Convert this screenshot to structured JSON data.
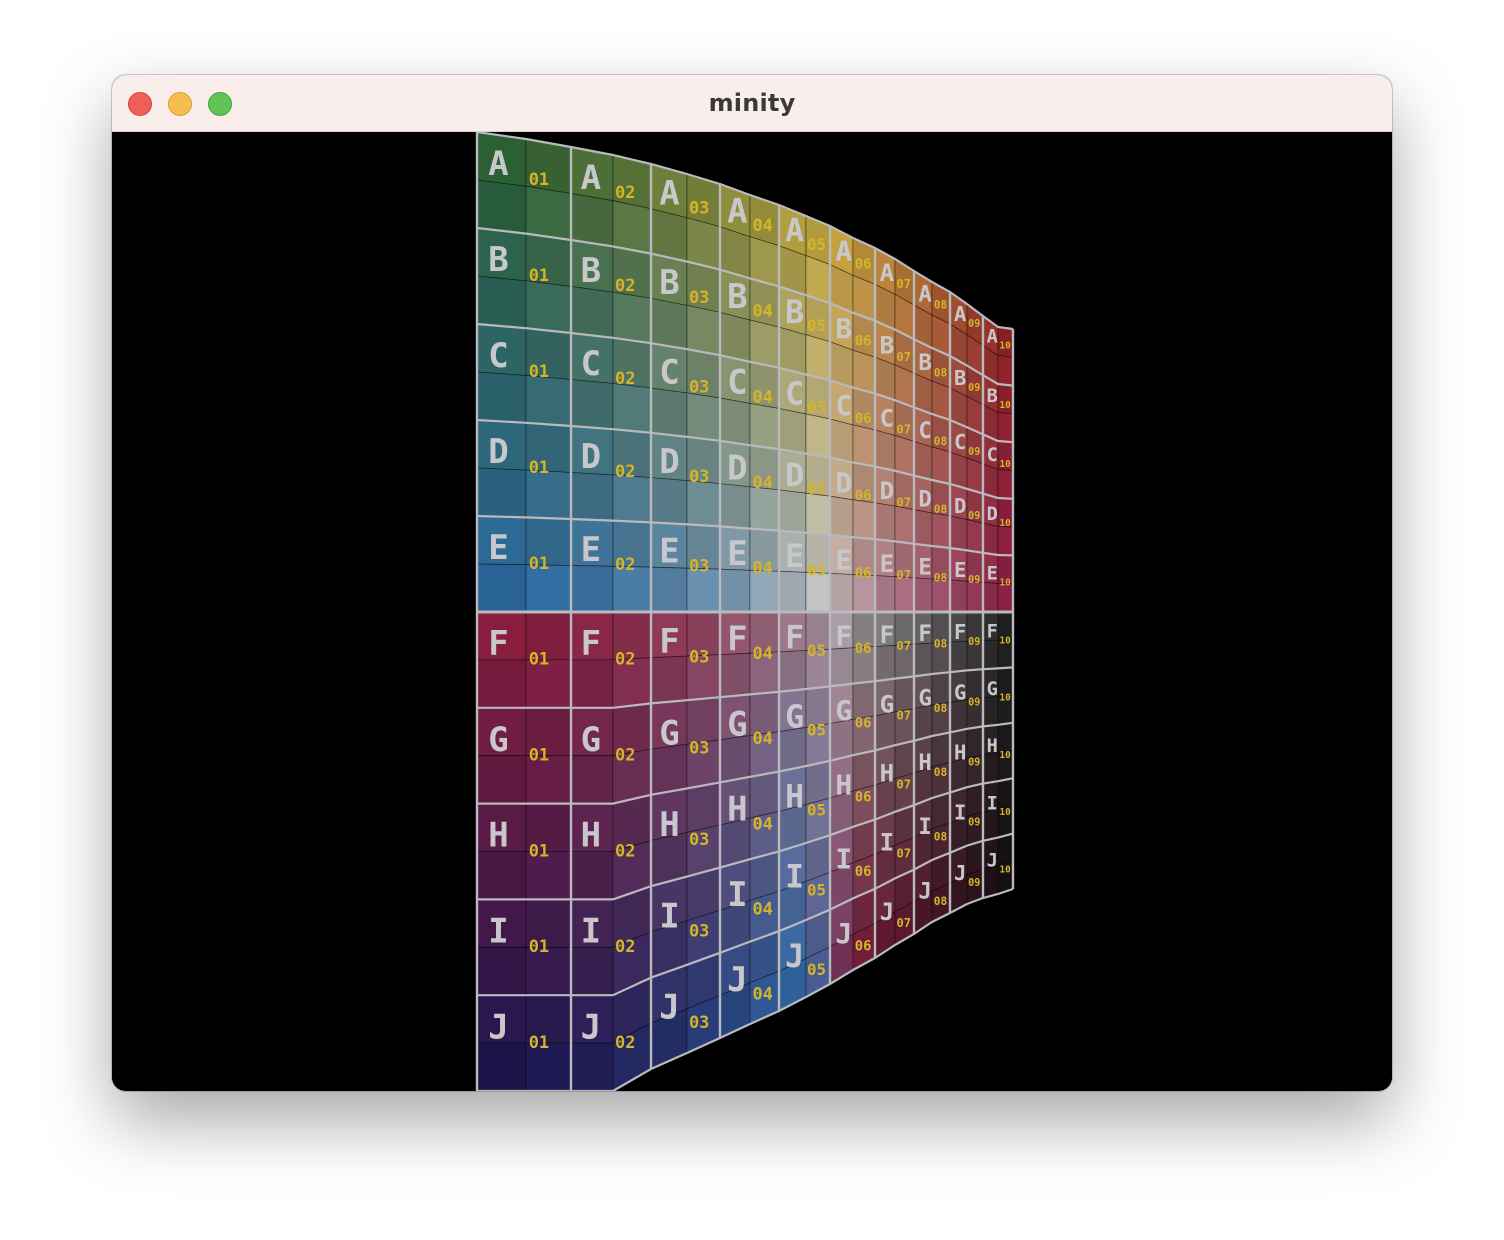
{
  "window": {
    "title": "minity",
    "buttons": {
      "close": "close",
      "minimize": "minimize",
      "zoom": "zoom"
    }
  },
  "scene": {
    "description_free": true,
    "columns": 10,
    "rows": 10,
    "row_letters": [
      "A",
      "B",
      "C",
      "D",
      "E",
      "F",
      "G",
      "H",
      "I",
      "J"
    ],
    "column_numbers": [
      "01",
      "02",
      "03",
      "04",
      "05",
      "06",
      "07",
      "08",
      "09",
      "10"
    ],
    "colors": {
      "top_left": "#235c2e",
      "top_center": "#c9a83a",
      "top_right": "#8e1c24",
      "mid_left": "#2b6aa6",
      "mid_right": "#8a1a45",
      "lower_top_left": "#8e1d3d",
      "lower_top_right": "#1c1c1c",
      "bottom_left": "#191550",
      "bottom_right": "#0e0e10",
      "grid_line": "#b9b9be",
      "label_text": "#c8c8cc",
      "number_text": "#d4b42a",
      "background": "#000000"
    }
  }
}
